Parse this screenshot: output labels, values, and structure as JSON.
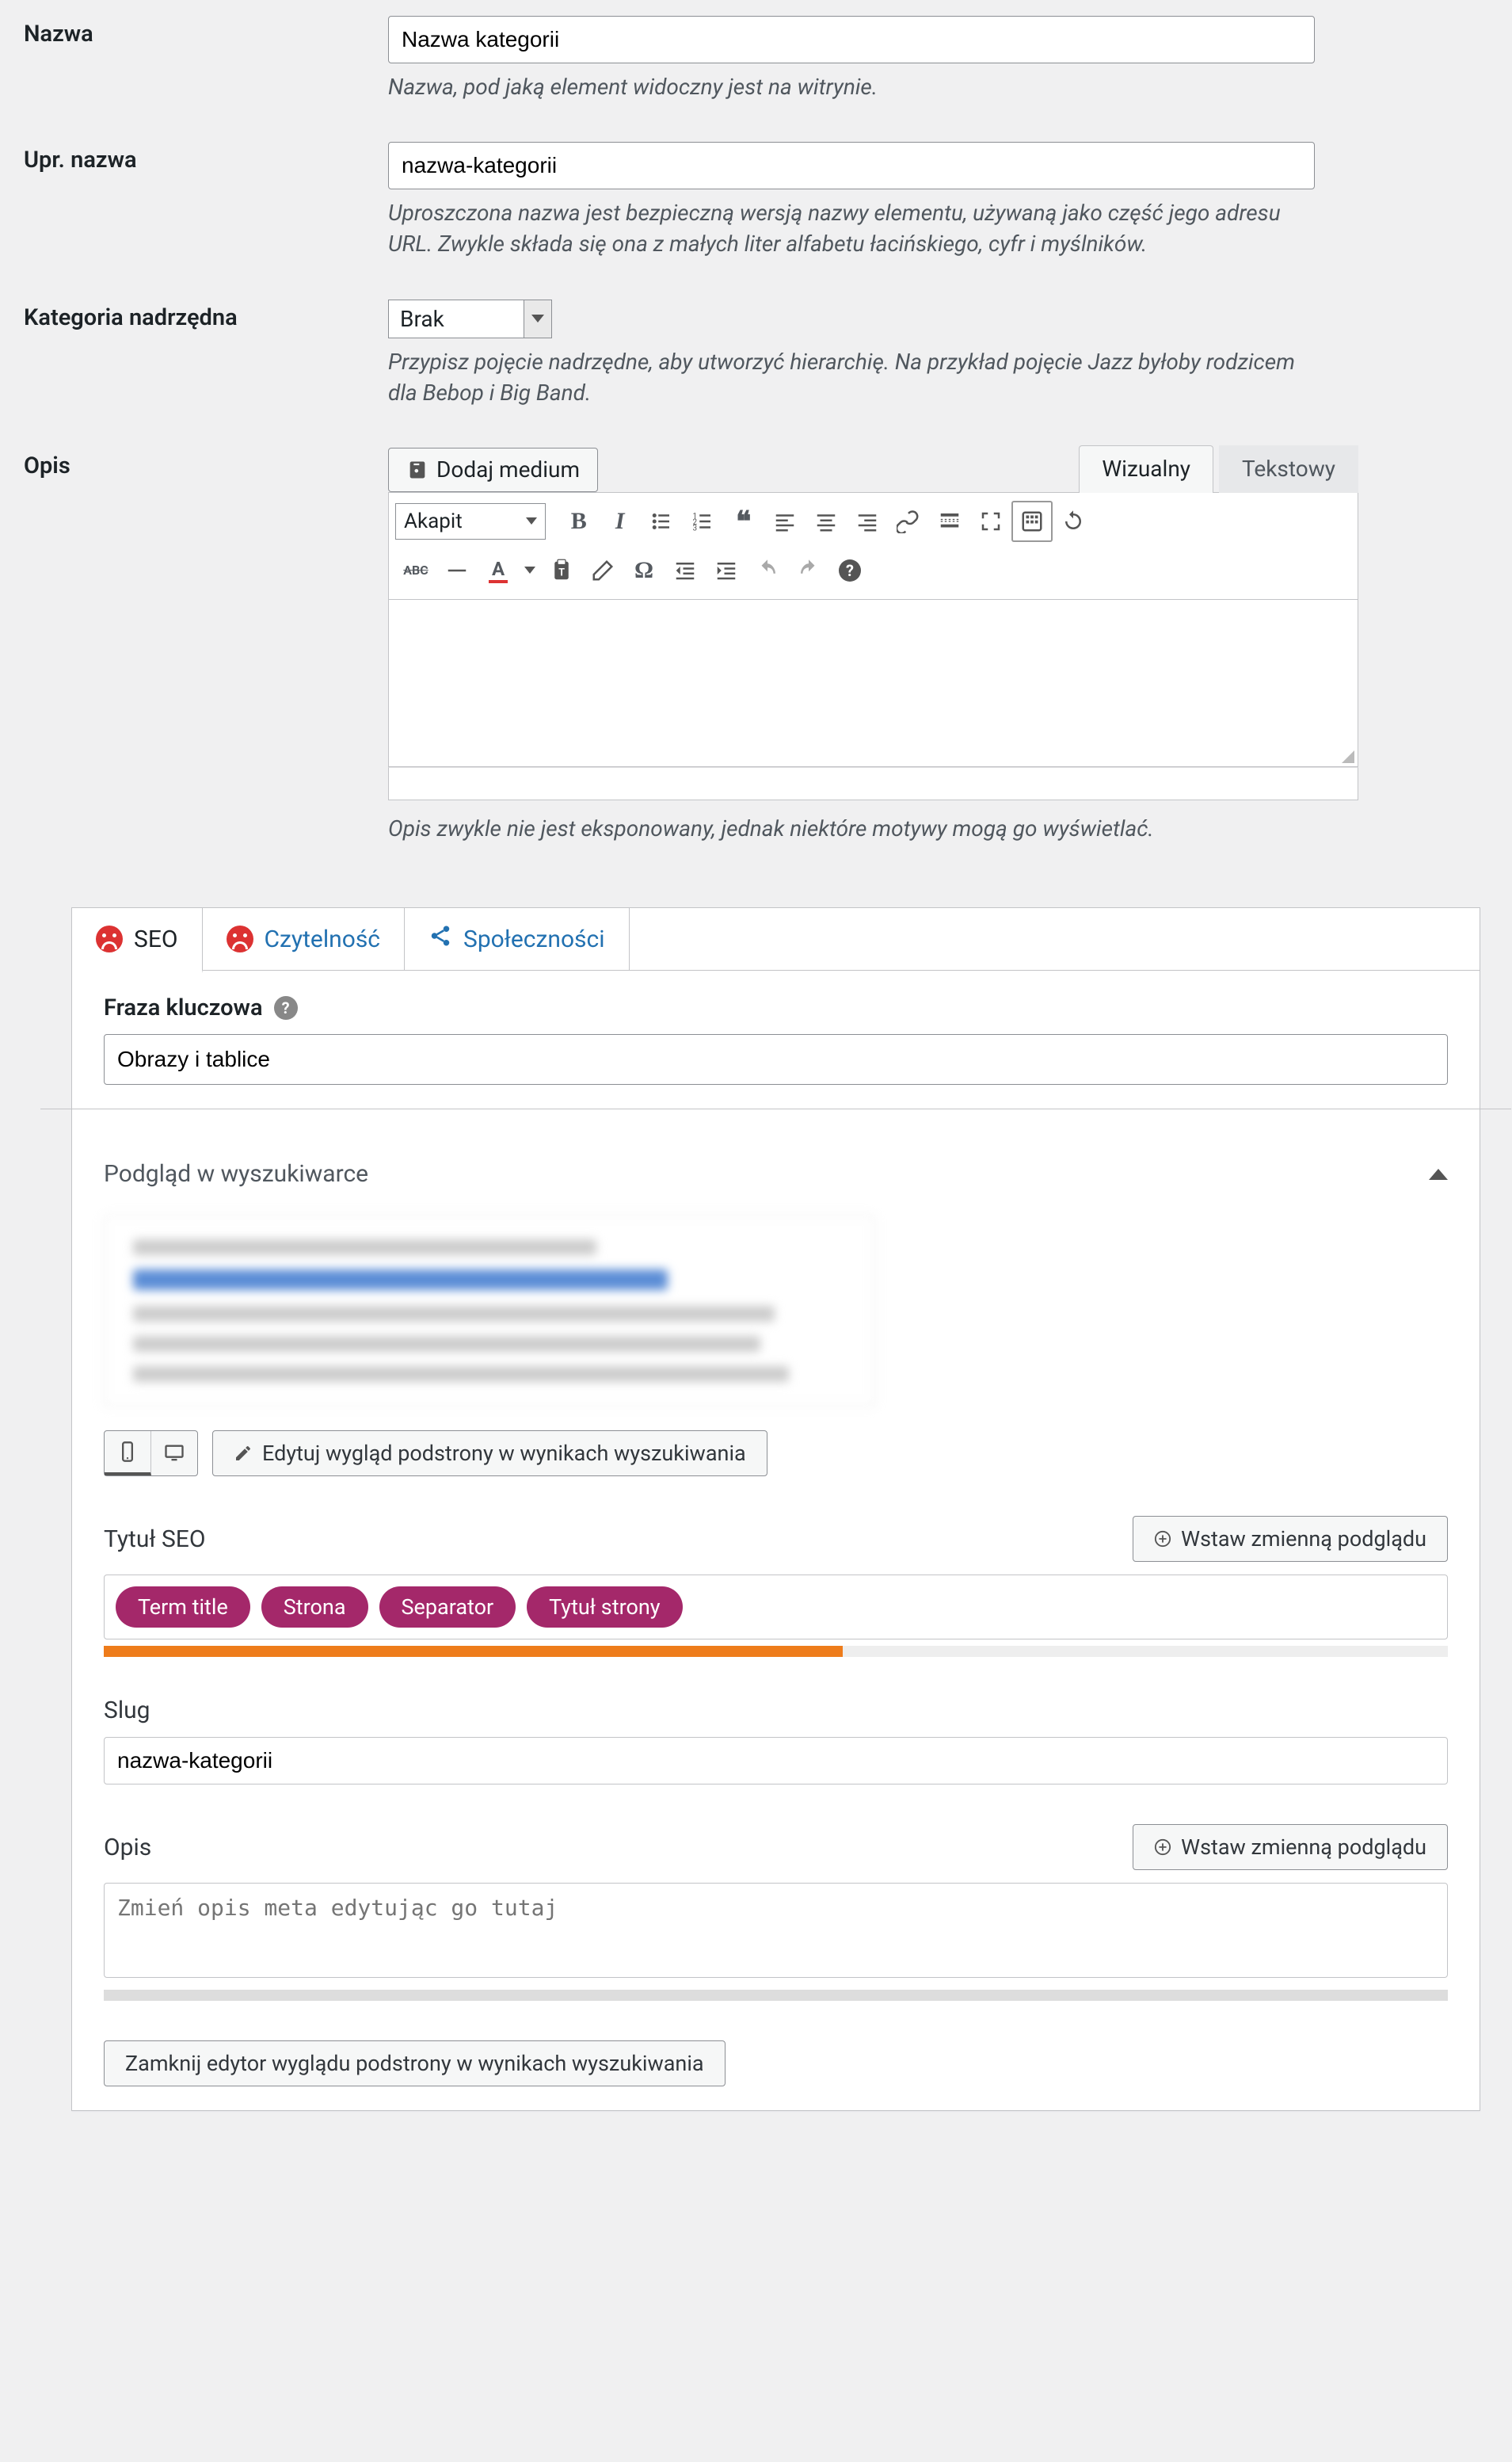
{
  "form": {
    "name": {
      "label": "Nazwa",
      "value": "Nazwa kategorii",
      "help": "Nazwa, pod jaką element widoczny jest na witrynie."
    },
    "slug": {
      "label": "Upr. nazwa",
      "value": "nazwa-kategorii",
      "help": "Uproszczona nazwa jest bezpieczną wersją nazwy elementu, używaną jako część jego adresu URL. Zwykle składa się ona z małych liter alfabetu łacińskiego, cyfr i myślników."
    },
    "parent": {
      "label": "Kategoria nadrzędna",
      "selected": "Brak",
      "help": "Przypisz pojęcie nadrzędne, aby utworzyć hierarchię. Na przykład pojęcie Jazz byłoby rodzicem dla Bebop i Big Band."
    },
    "desc": {
      "label": "Opis",
      "add_media": "Dodaj medium",
      "help": "Opis zwykle nie jest eksponowany, jednak niektóre motywy mogą go wyświetlać."
    }
  },
  "editor": {
    "tabs": {
      "visual": "Wizualny",
      "text": "Tekstowy"
    },
    "format": "Akapit"
  },
  "seo": {
    "tabs": {
      "seo": "SEO",
      "readability": "Czytelność",
      "social": "Społeczności"
    },
    "keyword_label": "Fraza kluczowa",
    "keyword_value": "Obrazy i tablice",
    "preview_heading": "Podgląd w wyszukiwarce",
    "edit_snippet": "Edytuj wygląd podstrony w wynikach wyszukiwania",
    "title_label": "Tytuł SEO",
    "insert_var": "Wstaw zmienną podglądu",
    "pills": [
      "Term title",
      "Strona",
      "Separator",
      "Tytuł strony"
    ],
    "slug_label": "Slug",
    "slug_value": "nazwa-kategorii",
    "desc_label": "Opis",
    "desc_placeholder": "Zmień opis meta edytując go tutaj",
    "close_editor": "Zamknij edytor wyglądu podstrony w wynikach wyszukiwania"
  }
}
